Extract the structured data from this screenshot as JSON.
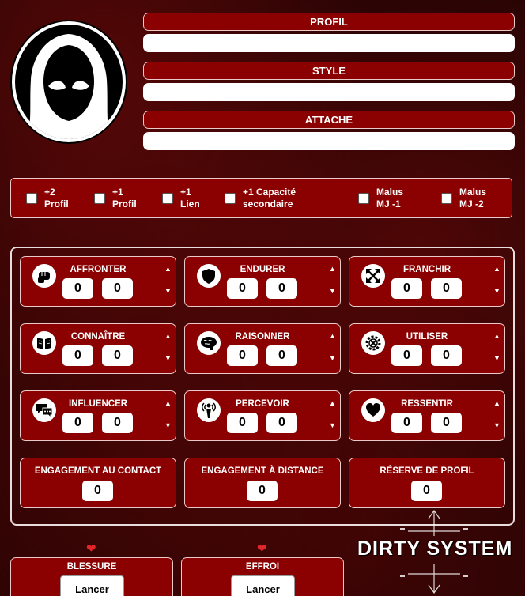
{
  "header": {
    "profil_label": "PROFIL",
    "profil_value": "",
    "style_label": "STYLE",
    "style_value": "",
    "attache_label": "ATTACHE",
    "attache_value": ""
  },
  "avatar_icon": "hooded-figure-icon",
  "modifiers": [
    {
      "label": "+2\nProfil",
      "checked": false
    },
    {
      "label": "+1\nProfil",
      "checked": false
    },
    {
      "label": "+1\nLien",
      "checked": false
    },
    {
      "label": "+1 Capacité\nsecondaire",
      "checked": false
    },
    {
      "label": "Malus\nMJ -1",
      "checked": false
    },
    {
      "label": "Malus\nMJ -2",
      "checked": false
    }
  ],
  "skills": [
    {
      "name": "AFFRONTER",
      "icon": "fist-icon",
      "v1": "0",
      "v2": "0"
    },
    {
      "name": "ENDURER",
      "icon": "shield-icon",
      "v1": "0",
      "v2": "0"
    },
    {
      "name": "FRANCHIR",
      "icon": "arrows-expand-icon",
      "v1": "0",
      "v2": "0"
    },
    {
      "name": "CONNAÎTRE",
      "icon": "book-icon",
      "v1": "0",
      "v2": "0"
    },
    {
      "name": "RAISONNER",
      "icon": "brain-icon",
      "v1": "0",
      "v2": "0"
    },
    {
      "name": "UTILISER",
      "icon": "gear-tools-icon",
      "v1": "0",
      "v2": "0"
    },
    {
      "name": "INFLUENCER",
      "icon": "speech-bubbles-icon",
      "v1": "0",
      "v2": "0"
    },
    {
      "name": "PERCEVOIR",
      "icon": "radar-person-icon",
      "v1": "0",
      "v2": "0"
    },
    {
      "name": "RESSENTIR",
      "icon": "heart-icon",
      "v1": "0",
      "v2": "0"
    }
  ],
  "engagements": [
    {
      "name": "ENGAGEMENT AU CONTACT",
      "value": "0"
    },
    {
      "name": "ENGAGEMENT À DISTANCE",
      "value": "0"
    },
    {
      "name": "RÉSERVE DE PROFIL",
      "value": "0"
    }
  ],
  "arrows": {
    "up": "▲",
    "down": "▼"
  },
  "logo_text": "DIRTY SYSTEM",
  "bottom": [
    {
      "name": "BLESSURE",
      "heart": "❤",
      "button": "Lancer"
    },
    {
      "name": "EFFROI",
      "heart": "❤",
      "button": "Lancer"
    }
  ],
  "colors": {
    "panel_red": "#8b0000",
    "heart_red": "#e3262a"
  }
}
